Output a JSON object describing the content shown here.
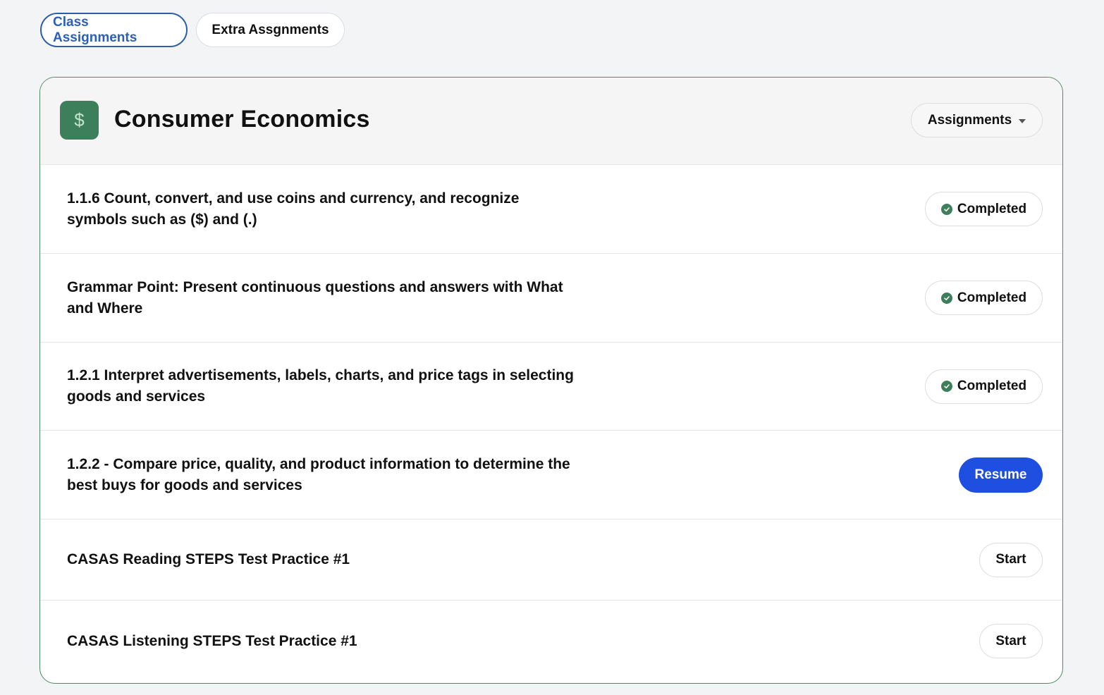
{
  "tabs": [
    {
      "label": "Class Assignments",
      "active": true
    },
    {
      "label": "Extra Assgnments",
      "active": false
    }
  ],
  "card": {
    "icon_symbol": "$",
    "icon_name": "dollar-icon",
    "title": "Consumer Economics",
    "dropdown_label": "Assignments"
  },
  "assignments": [
    {
      "title": "1.1.6 Count, convert, and use coins and currency, and recognize symbols such as ($) and (.)",
      "status": "Completed"
    },
    {
      "title": "Grammar Point: Present continuous questions and answers with What and Where",
      "status": "Completed"
    },
    {
      "title": "1.2.1 Interpret advertisements, labels, charts, and price tags in selecting goods and services",
      "status": "Completed"
    },
    {
      "title": "1.2.2 - Compare price, quality, and product information to determine the best buys for goods and services",
      "action": "Resume"
    },
    {
      "title": "CASAS Reading STEPS Test Practice #1",
      "action": "Start"
    },
    {
      "title": "CASAS Listening STEPS Test Practice #1",
      "action": "Start"
    }
  ],
  "colors": {
    "accent_blue": "#1f4fe0",
    "tab_active": "#2b5fb8",
    "subject_green": "#3e7f5b",
    "card_border": "#4e8a68"
  }
}
